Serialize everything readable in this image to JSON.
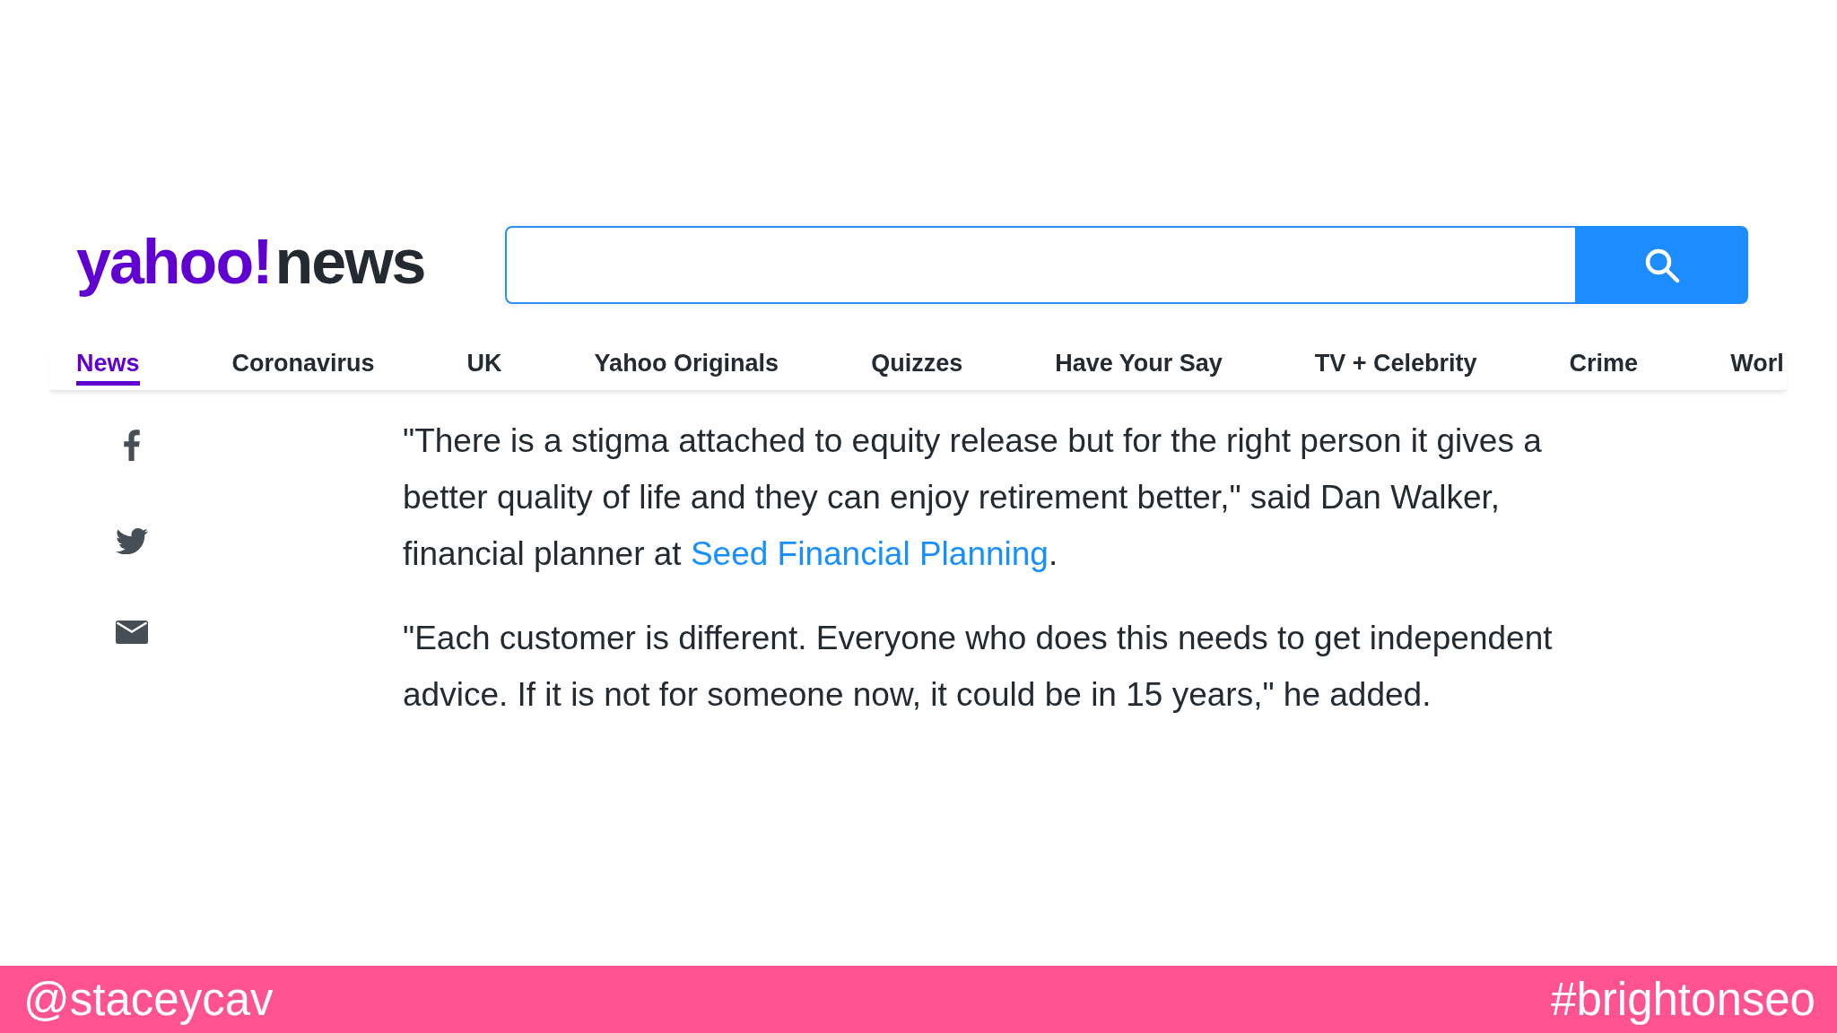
{
  "logo": {
    "brand": "yahoo!",
    "section": "news"
  },
  "nav": [
    {
      "label": "News",
      "selected": true
    },
    {
      "label": "Coronavirus",
      "selected": false
    },
    {
      "label": "UK",
      "selected": false
    },
    {
      "label": "Yahoo Originals",
      "selected": false
    },
    {
      "label": "Quizzes",
      "selected": false
    },
    {
      "label": "Have Your Say",
      "selected": false
    },
    {
      "label": "TV + Celebrity",
      "selected": false
    },
    {
      "label": "Crime",
      "selected": false
    },
    {
      "label": "Worl",
      "selected": false
    }
  ],
  "article": {
    "paragraphs": [
      {
        "parts": [
          {
            "kind": "text",
            "text": "\"There is a stigma attached to equity release but for the right person it gives a better quality of life and they can enjoy retirement better,\" said Dan Walker, financial planner at "
          },
          {
            "kind": "link",
            "text": "Seed Financial Planning"
          },
          {
            "kind": "text",
            "text": "."
          }
        ]
      },
      {
        "parts": [
          {
            "kind": "text",
            "text": "\"Each customer is different. Everyone who does this needs to get independent advice. If it is not for someone now, it could be in 15 years,\" he added."
          }
        ]
      }
    ]
  },
  "footer": {
    "handle": "@staceycav",
    "hashtag": "#brightonseo"
  }
}
